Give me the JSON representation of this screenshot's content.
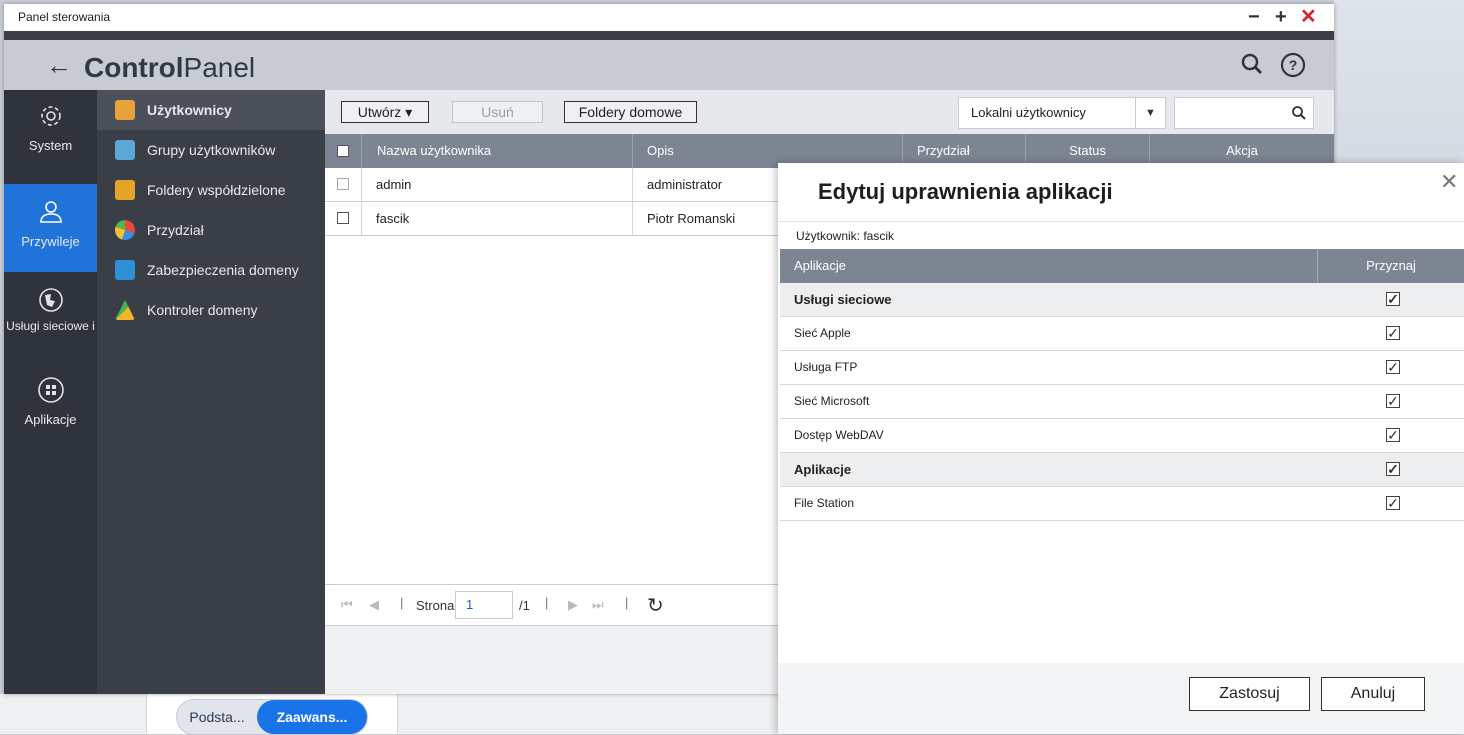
{
  "window": {
    "title": "Panel sterowania",
    "controls": [
      "minimize-icon",
      "maximize-icon",
      "close-icon"
    ]
  },
  "header": {
    "brand_bold": "Control",
    "brand_light": "Panel",
    "icons": [
      "back-arrow-icon",
      "search-icon",
      "help-icon"
    ]
  },
  "rail": [
    {
      "label": "System",
      "icon": "gear-icon"
    },
    {
      "label": "Przywileje",
      "icon": "user-icon",
      "active": true
    },
    {
      "label": "Usługi sieciowe i",
      "icon": "globe-icon"
    },
    {
      "label": "Aplikacje",
      "icon": "apps-grid-icon"
    }
  ],
  "nav": [
    {
      "label": "Użytkownicy",
      "active": true
    },
    {
      "label": "Grupy użytkowników"
    },
    {
      "label": "Foldery współdzielone"
    },
    {
      "label": "Przydział"
    },
    {
      "label": "Zabezpieczenia domeny"
    },
    {
      "label": "Kontroler domeny"
    }
  ],
  "toolbar": {
    "create": "Utwórz ▾",
    "delete": "Usuń",
    "home_folders": "Foldery domowe",
    "filter": "Lokalni użytkownicy"
  },
  "table": {
    "columns": [
      "Nazwa użytkownika",
      "Opis",
      "Przydział",
      "Status",
      "Akcja"
    ],
    "rows": [
      {
        "name": "admin",
        "desc": "administrator"
      },
      {
        "name": "fascik",
        "desc": "Piotr Romanski"
      }
    ]
  },
  "pager": {
    "label": "Strona",
    "page": "1",
    "total": "/1"
  },
  "modal": {
    "title": "Edytuj uprawnienia aplikacji",
    "user": "Użytkownik: fascik",
    "col_apps": "Aplikacje",
    "col_grant": "Przyznaj",
    "rows": [
      {
        "label": "Usługi sieciowe",
        "group": true
      },
      {
        "label": "Sieć Apple"
      },
      {
        "label": "Usługa FTP"
      },
      {
        "label": "Sieć Microsoft"
      },
      {
        "label": "Dostęp WebDAV"
      },
      {
        "label": "Aplikacje",
        "group": true
      },
      {
        "label": "File Station"
      }
    ],
    "apply": "Zastosuj",
    "cancel": "Anuluj"
  },
  "taskbar": {
    "basic": "Podsta...",
    "advanced": "Zaawans..."
  }
}
